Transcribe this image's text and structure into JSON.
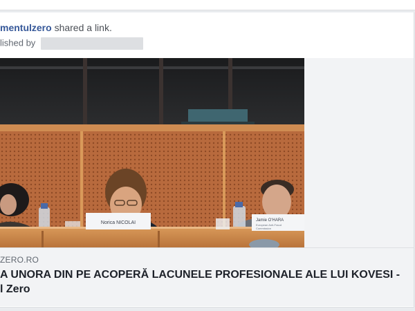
{
  "post": {
    "author": "mentulzero",
    "action": " shared a link.",
    "published_prefix": "lished by"
  },
  "preview": {
    "domain": "ZERO.RO",
    "headline_line1": "A UNORA DIN PE ACOPERĂ LACUNELE PROFESIONALE ALE LUI KOVESI -",
    "headline_line2": "l Zero"
  },
  "photo": {
    "nameplate_center": "Norica NICOLAI",
    "nameplate_right_name": "Jamie O'HARA",
    "nameplate_right_sub1": "European Anti-Fraud",
    "nameplate_right_sub2": "Commission"
  }
}
